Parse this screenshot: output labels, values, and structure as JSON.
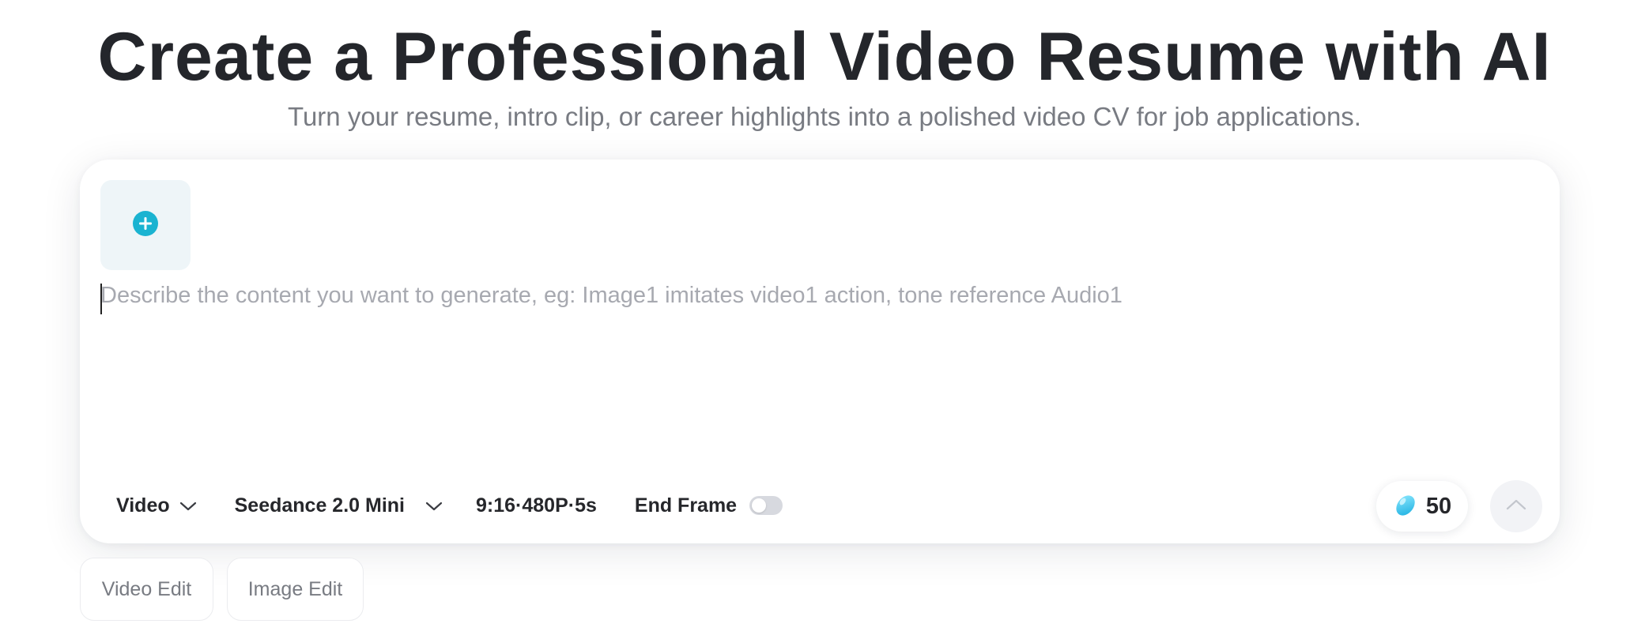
{
  "hero": {
    "title": "Create a Professional Video Resume with AI",
    "subtitle": "Turn your resume, intro clip, or career highlights into a polished video CV for job applications."
  },
  "composer": {
    "upload_icon": "plus-circle-icon",
    "prompt_value": "",
    "prompt_placeholder": "Describe the content you want to generate, eg: Image1 imitates video1 action, tone reference Audio1",
    "toolbar": {
      "mode_label": "Video",
      "model_label": "Seedance 2.0 Mini",
      "specs_label": "9:16·480P·5s",
      "end_frame_label": "End Frame",
      "end_frame_enabled": false
    },
    "credits": {
      "icon": "bean-credit-icon",
      "value": "50"
    },
    "submit_icon": "chevron-up-icon"
  },
  "chips": {
    "video_edit": "Video Edit",
    "image_edit": "Image Edit"
  },
  "colors": {
    "accent": "#1ab3d1",
    "title": "#24262b",
    "subtitle": "#787b82",
    "placeholder": "#a7a9b0"
  }
}
